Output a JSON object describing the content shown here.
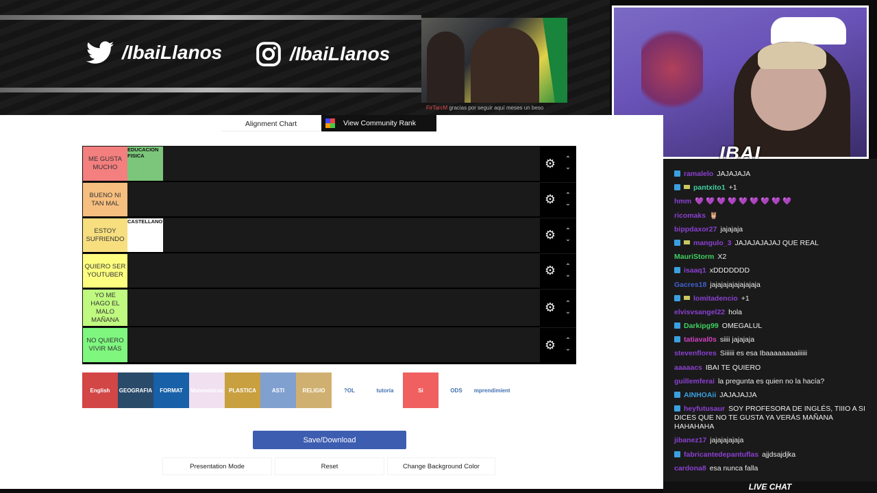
{
  "banner": {
    "twitter_handle": "/IbaiLlanos",
    "instagram_handle": "/IbaiLlanos",
    "sub_alert": {
      "user": "FirTarcM",
      "message": "gracias por seguir aquí",
      "months": "meses un beso"
    }
  },
  "webcam": {
    "streamer_label": "IBAI"
  },
  "page": {
    "tab_alignment": "Alignment Chart",
    "tab_community": "View Community Rank",
    "tiers": [
      {
        "label": "ME GUSTA MUCHO",
        "color": "#f47f7f",
        "items": [
          {
            "text": "EDUCACION FISICA",
            "bg": "#7bc67a"
          }
        ]
      },
      {
        "label": "BUENO NI TAN MAL",
        "color": "#f7bf7f",
        "items": []
      },
      {
        "label": "ESTOY SUFRIENDO",
        "color": "#f7df7f",
        "items": [
          {
            "text": "CASTELLANO",
            "bg": "#ffffff"
          }
        ]
      },
      {
        "label": "QUIERO SER YOUTUBER",
        "color": "#fdfd7f",
        "items": []
      },
      {
        "label": "YO ME HAGO EL MALO MAÑANA",
        "color": "#bff97f",
        "items": []
      },
      {
        "label": "NO QUIERO VIVIR MÁS",
        "color": "#7ff77f",
        "items": []
      }
    ],
    "pool_items": [
      {
        "text": "English",
        "bg": "#d24646"
      },
      {
        "text": "GEOGRAFIA",
        "bg": "#2a4a6a"
      },
      {
        "text": "FORMAT",
        "bg": "#1860a8"
      },
      {
        "text": "Matemáticas",
        "bg": "#f0e0f0"
      },
      {
        "text": "PLASTICA",
        "bg": "#c8a040"
      },
      {
        "text": "ASTI",
        "bg": "#80a0d0"
      },
      {
        "text": "RELIGIO",
        "bg": "#d0b070"
      },
      {
        "text": "?OL",
        "bg": "#ffffff"
      },
      {
        "text": "tutoría",
        "bg": "#ffffff"
      },
      {
        "text": "Si",
        "bg": "#f06060"
      },
      {
        "text": "ODS",
        "bg": "#ffffff"
      },
      {
        "text": "Emprendimiento",
        "bg": "#ffffff"
      }
    ],
    "save_label": "Save/Download",
    "presentation_label": "Presentation Mode",
    "reset_label": "Reset",
    "bgcolor_label": "Change Background Color"
  },
  "chat": {
    "messages": [
      {
        "user": "ramalelo",
        "color": "#8a40d0",
        "badge": true,
        "badge2": false,
        "text": "JAJAJAJA"
      },
      {
        "user": "pantxito1",
        "color": "#40d0a0",
        "badge": true,
        "badge2": true,
        "text": "+1"
      },
      {
        "user": "hmm",
        "color": "#8a40d0",
        "badge": false,
        "badge2": false,
        "text": "💜 💜 💜 💜 💜 💜 💜 💜 💜"
      },
      {
        "user": "ricomaks",
        "color": "#8a40d0",
        "badge": false,
        "badge2": false,
        "text": "🦉"
      },
      {
        "user": "bippdaxor27",
        "color": "#8a40d0",
        "badge": false,
        "badge2": false,
        "text": "jajajaja"
      },
      {
        "user": "mangulo_3",
        "color": "#8a40d0",
        "badge": true,
        "badge2": true,
        "text": "JAJAJAJAJAJ QUE REAL"
      },
      {
        "user": "MauriStorm",
        "color": "#40d060",
        "badge": false,
        "badge2": false,
        "text": "X2"
      },
      {
        "user": "isaaq1",
        "color": "#8a40d0",
        "badge": true,
        "badge2": false,
        "text": "xDDDDDDD"
      },
      {
        "user": "Gacres18",
        "color": "#4060d0",
        "badge": false,
        "badge2": false,
        "text": "jajajajajajajajaja"
      },
      {
        "user": "lomitadencio",
        "color": "#8a40d0",
        "badge": true,
        "badge2": true,
        "text": "+1"
      },
      {
        "user": "elvisvsangel22",
        "color": "#8a40d0",
        "badge": false,
        "badge2": false,
        "text": "hola"
      },
      {
        "user": "Darkipg99",
        "color": "#40d060",
        "badge": true,
        "badge2": false,
        "text": "OMEGALUL"
      },
      {
        "user": "tatiaval0s",
        "color": "#d040c0",
        "badge": true,
        "badge2": false,
        "text": "siiii jajajaja"
      },
      {
        "user": "stevenflores",
        "color": "#8a40d0",
        "badge": false,
        "badge2": false,
        "text": "Siiiiii es esa Ibaaaaaaaaiiiiii"
      },
      {
        "user": "aaaaacs",
        "color": "#8a40d0",
        "badge": false,
        "badge2": false,
        "text": "IBAI TE QUIERO"
      },
      {
        "user": "guillemferai",
        "color": "#8a40d0",
        "badge": false,
        "badge2": false,
        "text": "la pregunta es quien no la hacía?"
      },
      {
        "user": "AINHOAii",
        "color": "#3ba0e0",
        "badge": true,
        "badge2": false,
        "text": "JAJAJAJJA"
      },
      {
        "user": "heyfutusaur",
        "color": "#8a40d0",
        "badge": true,
        "badge2": false,
        "text": "SOY PROFESORA DE INGLÉS, TIIIO A SI DICES QUE NO TE GUSTA YA VERÁS MAÑANA HAHAHAHA"
      },
      {
        "user": "jibanez17",
        "color": "#8a40d0",
        "badge": false,
        "badge2": false,
        "text": "jajajajajaja"
      },
      {
        "user": "fabricantedepantuflas",
        "color": "#8a40d0",
        "badge": true,
        "badge2": false,
        "text": "ajjdsajdjka"
      },
      {
        "user": "cardona8",
        "color": "#8a40d0",
        "badge": false,
        "badge2": false,
        "text": "esa nunca falla"
      }
    ],
    "footer": "LIVE CHAT"
  }
}
